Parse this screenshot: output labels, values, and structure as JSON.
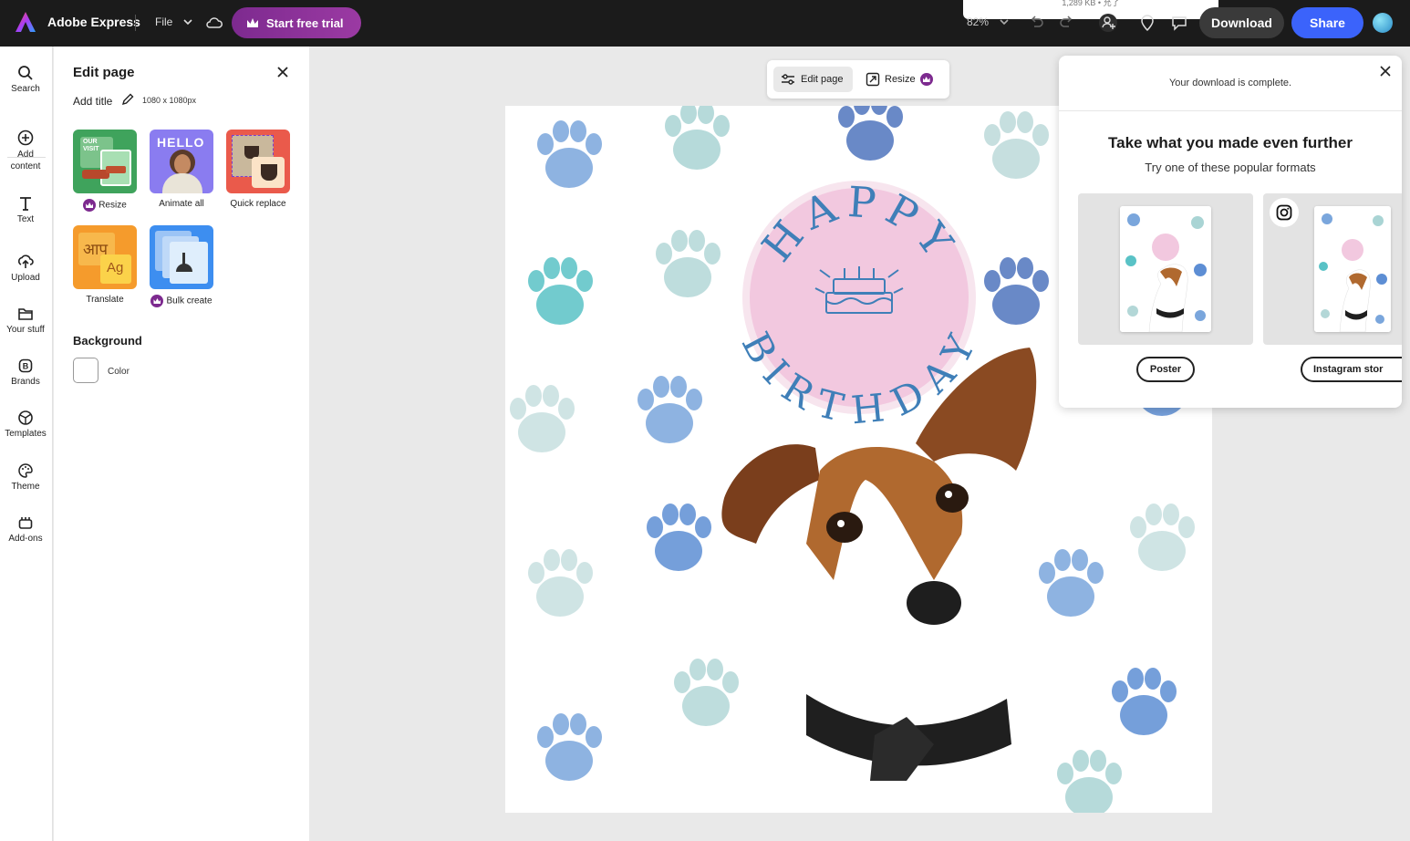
{
  "app": {
    "title": "Adobe Express",
    "file_menu": "File",
    "trial_button": "Start free trial",
    "zoom": "82%",
    "file_info": "1,289 KB • 允了",
    "download_button": "Download",
    "share_button": "Share"
  },
  "rail": {
    "items": [
      {
        "label": "Search",
        "icon": "search-icon"
      },
      {
        "label": "Add content",
        "icon": "plus-circle-icon"
      },
      {
        "label": "Text",
        "icon": "text-icon"
      },
      {
        "label": "Upload",
        "icon": "upload-icon"
      },
      {
        "label": "Your stuff",
        "icon": "folder-icon"
      },
      {
        "label": "Brands",
        "icon": "brand-icon"
      },
      {
        "label": "Templates",
        "icon": "templates-icon"
      },
      {
        "label": "Theme",
        "icon": "palette-icon"
      },
      {
        "label": "Add-ons",
        "icon": "addons-icon"
      }
    ]
  },
  "panel": {
    "title": "Edit page",
    "add_title": "Add title",
    "dimensions": "1080 x 1080px",
    "tools": [
      {
        "label": "Resize",
        "premium": true
      },
      {
        "label": "Animate all",
        "premium": false
      },
      {
        "label": "Quick replace",
        "premium": false
      },
      {
        "label": "Translate",
        "premium": false
      },
      {
        "label": "Bulk create",
        "premium": true
      }
    ],
    "tile_text": {
      "hello": "HELLO",
      "translate_glyph": "आप",
      "ag": "Ag",
      "our_visit": "OUR VISIT"
    },
    "background_heading": "Background",
    "color_label": "Color"
  },
  "canvas": {
    "edit_page_tab": "Edit page",
    "resize_tab": "Resize",
    "artwork_text_top": "HAPPY",
    "artwork_text_bottom": "BIRTHDAY"
  },
  "popup": {
    "message": "Your download is complete.",
    "heading": "Take what you made even further",
    "subheading": "Try one of these popular formats",
    "formats": [
      {
        "label": "Poster"
      },
      {
        "label": "Instagram stor"
      }
    ]
  },
  "colors": {
    "topbar": "#1b1b1b",
    "trial": "#7d2a8f",
    "share": "#3b63fb",
    "badge_pink": "#f2c8df",
    "birthday_blue": "#3f7fb8"
  }
}
